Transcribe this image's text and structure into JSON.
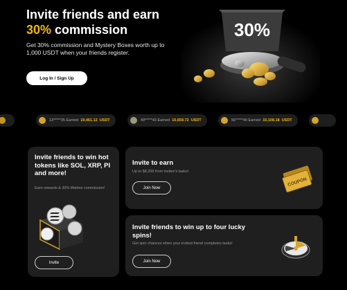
{
  "hero": {
    "title_line1": "Invite friends and earn",
    "title_accent": "30%",
    "title_rest": " commission",
    "description": "Get 30% commission and Mystery Boxes worth up to 1,000 USDT when your friends register.",
    "login_label": "Log In / Sign Up",
    "badge_text": "30%"
  },
  "ticker": [
    {
      "user": "13*****35",
      "earned_label": "Earned",
      "amount": "19,461.12",
      "currency": "USDT"
    },
    {
      "user": "49*****43",
      "earned_label": "Earned",
      "amount": "15,659.72",
      "currency": "USDT"
    },
    {
      "user": "56*****40",
      "earned_label": "Earned",
      "amount": "15,108.18",
      "currency": "USDT"
    }
  ],
  "cards": {
    "hot_tokens": {
      "title": "Invite friends to win hot tokens like SOL, XRP, PI and more!",
      "subtitle": "Earn rewards & 30% lifetime commission!",
      "button": "Invite"
    },
    "invite_to_earn": {
      "title": "Invite to earn",
      "subtitle": "Up to $8,200 from invitee's tasks!",
      "button": "Join Now",
      "coupon_text": "COUPON"
    },
    "lucky_spins": {
      "title": "Invite friends to win up to four lucky spins!",
      "subtitle": "Get spin chances when your invited friend completes tasks!",
      "button": "Join Now"
    }
  },
  "colors": {
    "accent": "#f0b90b",
    "card_bg": "#1f1f1f",
    "page_bg": "#000000"
  }
}
